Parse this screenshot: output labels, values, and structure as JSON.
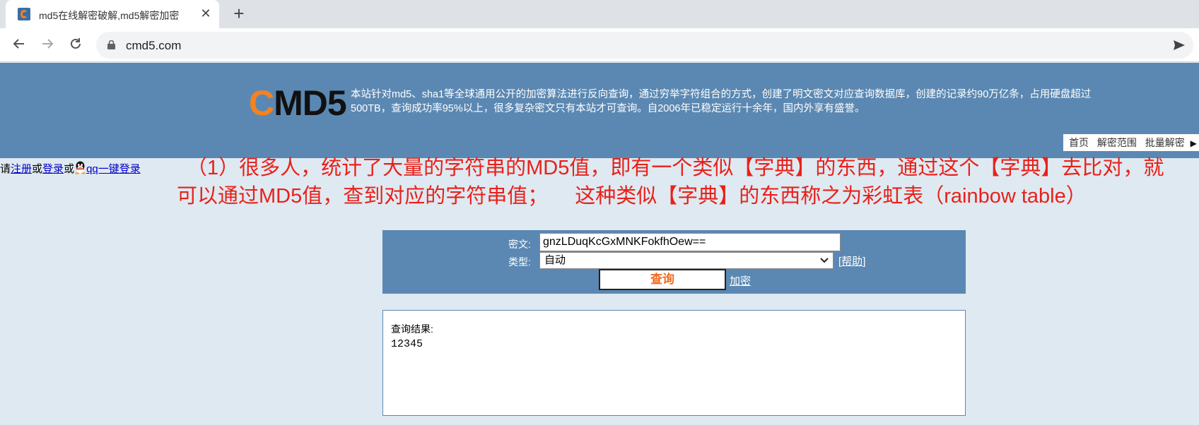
{
  "browser": {
    "tab_title": "md5在线解密破解,md5解密加密",
    "tab_close": "✕",
    "new_tab": "+",
    "url": "cmd5.com"
  },
  "site": {
    "logo_c": "C",
    "logo_rest": "MD5",
    "description": "本站针对md5、sha1等全球通用公开的加密算法进行反向查询，通过穷举字符组合的方式，创建了明文密文对应查询数据库，创建的记录约90万亿条，占用硬盘超过500TB，查询成功率95%以上，很多复杂密文只有本站才可查询。自2006年已稳定运行十余年，国内外享有盛誉。",
    "nav": [
      "首页",
      "解密范围",
      "批量解密"
    ]
  },
  "login": {
    "prefix": "请",
    "register": "注册",
    "or1": "或",
    "login": "登录",
    "or2": "或",
    "qq_login": "qq一键登录"
  },
  "annotation": {
    "line1": "（1）很多人，统计了大量的字符串的MD5值，即有一个类似【字典】的东西，通过这个【字典】去比对，就",
    "line2a": "可以通过MD5值，查到对应的字符串值；",
    "line2b": "这种类似【字典】的东西称之为彩虹表（rainbow table）"
  },
  "query": {
    "cipher_label": "密文:",
    "cipher_value": "gnzLDuqKcGxMNKFokfhOew==",
    "type_label": "类型:",
    "type_value": "自动",
    "help_open": "[",
    "help": "帮助",
    "help_close": "]",
    "submit": "查询",
    "encrypt": "加密"
  },
  "result": {
    "label": "查询结果:",
    "value": "12345"
  }
}
